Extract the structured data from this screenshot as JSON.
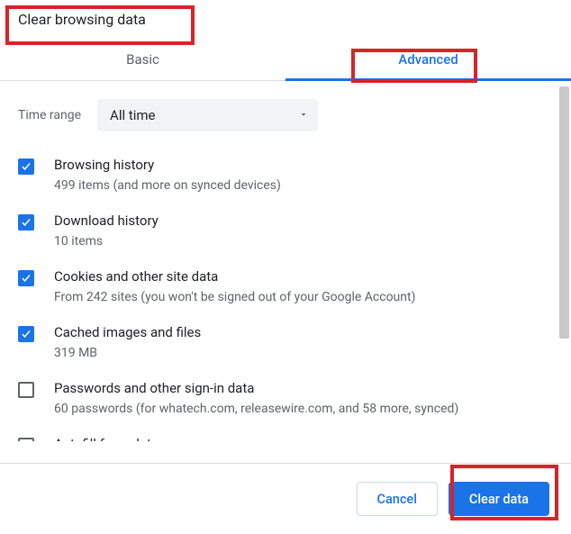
{
  "title": "Clear browsing data",
  "tabs": {
    "basic": "Basic",
    "advanced": "Advanced"
  },
  "time_range": {
    "label": "Time range",
    "value": "All time"
  },
  "options": [
    {
      "checked": true,
      "title": "Browsing history",
      "sub": "499 items (and more on synced devices)"
    },
    {
      "checked": true,
      "title": "Download history",
      "sub": "10 items"
    },
    {
      "checked": true,
      "title": "Cookies and other site data",
      "sub": "From 242 sites (you won't be signed out of your Google Account)"
    },
    {
      "checked": true,
      "title": "Cached images and files",
      "sub": "319 MB"
    },
    {
      "checked": false,
      "title": "Passwords and other sign-in data",
      "sub": "60 passwords (for whatech.com, releasewire.com, and 58 more, synced)"
    },
    {
      "checked": false,
      "title": "Autofill form data",
      "sub": ""
    }
  ],
  "footer": {
    "cancel": "Cancel",
    "clear": "Clear data"
  }
}
